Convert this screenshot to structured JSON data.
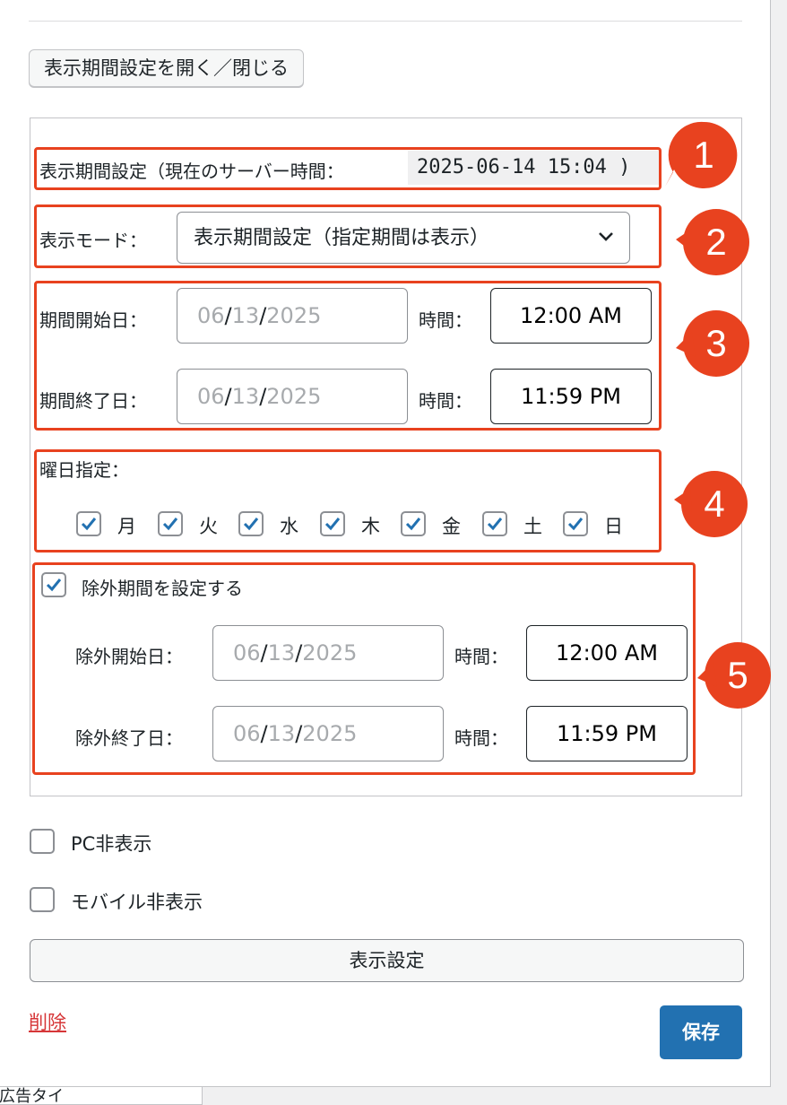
{
  "toggle_button": "表示期間設定を開く／閉じる",
  "schedule": {
    "header_label": "表示期間設定（現在のサーバー時間：",
    "server_time": "2025-06-14 15:04 )",
    "mode_label": "表示モード：",
    "mode_value": "表示期間設定（指定期間は表示）",
    "start_label": "期間開始日：",
    "start_date": {
      "mm": "06",
      "dd": "13",
      "yyyy": "2025",
      "sep": "/"
    },
    "start_time_label": "時間：",
    "start_time": "12:00 AM",
    "end_label": "期間終了日：",
    "end_date": {
      "mm": "06",
      "dd": "13",
      "yyyy": "2025",
      "sep": "/"
    },
    "end_time_label": "時間：",
    "end_time": "11:59 PM",
    "weekday_label": "曜日指定：",
    "weekdays": [
      {
        "label": "月",
        "checked": true
      },
      {
        "label": "火",
        "checked": true
      },
      {
        "label": "水",
        "checked": true
      },
      {
        "label": "木",
        "checked": true
      },
      {
        "label": "金",
        "checked": true
      },
      {
        "label": "土",
        "checked": true
      },
      {
        "label": "日",
        "checked": true
      }
    ],
    "exclusion_checkbox_label": "除外期間を設定する",
    "exclusion_checked": true,
    "ex_start_label": "除外開始日：",
    "ex_start_date": {
      "mm": "06",
      "dd": "13",
      "yyyy": "2025",
      "sep": "/"
    },
    "ex_start_time_label": "時間：",
    "ex_start_time": "12:00 AM",
    "ex_end_label": "除外終了日：",
    "ex_end_date": {
      "mm": "06",
      "dd": "13",
      "yyyy": "2025",
      "sep": "/"
    },
    "ex_end_time_label": "時間：",
    "ex_end_time": "11:59 PM"
  },
  "pc_hide": {
    "label": "PC非表示",
    "checked": false
  },
  "mobile_hide": {
    "label": "モバイル非表示",
    "checked": false
  },
  "display_settings_button": "表示設定",
  "delete_link": "削除",
  "save_button": "保存",
  "behind_text": "広告タイ",
  "markers": [
    "1",
    "2",
    "3",
    "4",
    "5"
  ],
  "colors": {
    "highlight": "#e8421f",
    "primary": "#2271b1",
    "check": "#2271b1",
    "delete": "#d63638"
  }
}
